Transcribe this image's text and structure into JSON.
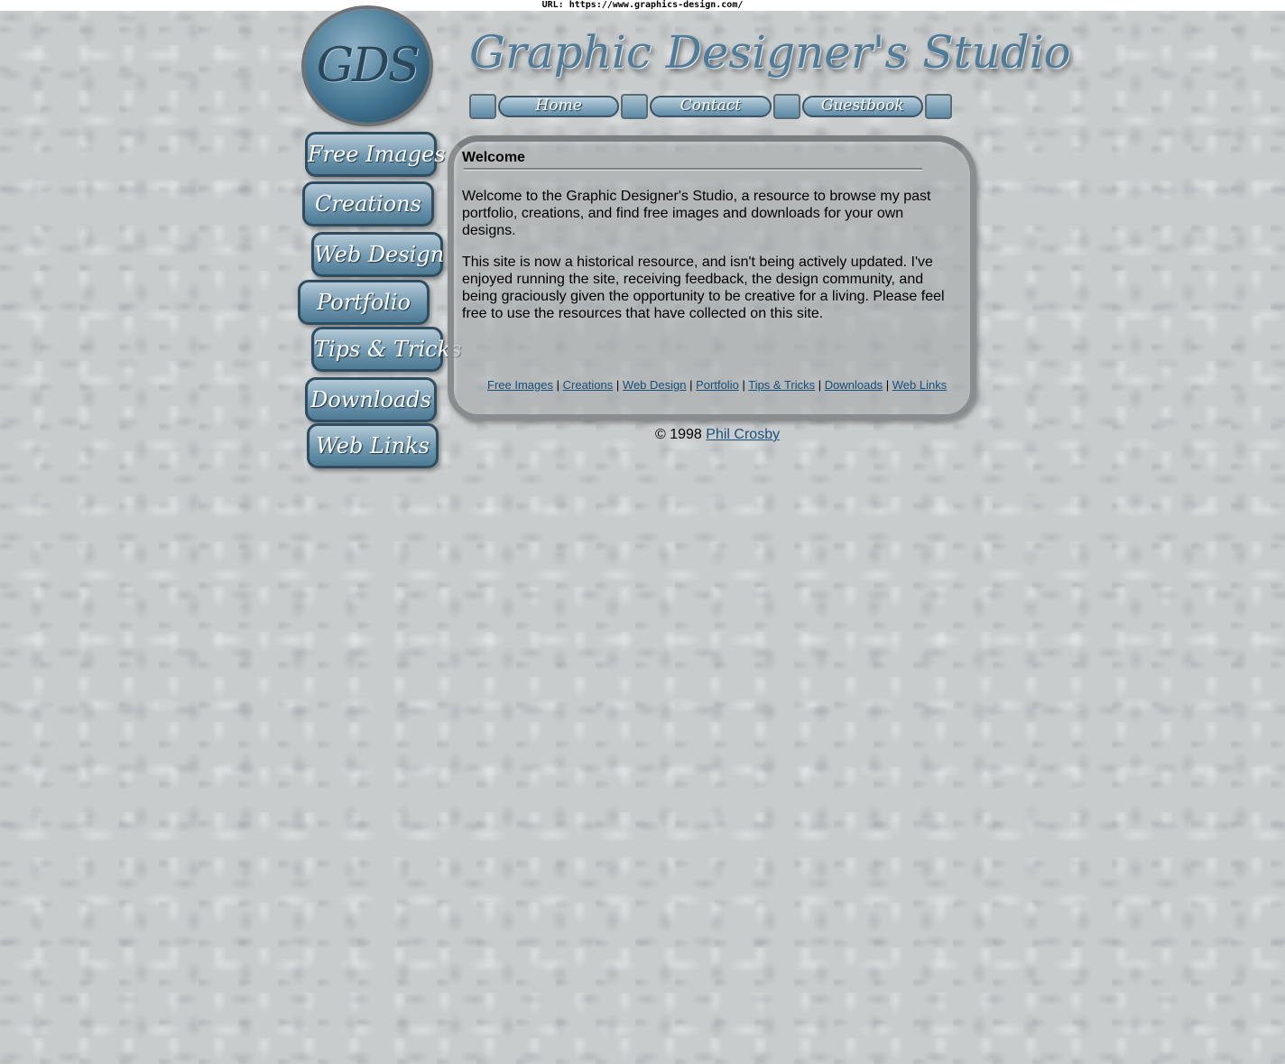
{
  "url_bar": {
    "label": "URL: https://www.graphics-design.com/"
  },
  "logo": {
    "text": "GDS"
  },
  "site_title": "Graphic Designer's Studio",
  "top_nav": {
    "items": [
      {
        "label": "Home"
      },
      {
        "label": "Contact"
      },
      {
        "label": "Guestbook"
      }
    ]
  },
  "side_nav": {
    "items": [
      {
        "label": "Free Images"
      },
      {
        "label": "Creations"
      },
      {
        "label": "Web Design"
      },
      {
        "label": "Portfolio"
      },
      {
        "label": "Tips & Tricks"
      },
      {
        "label": "Downloads"
      },
      {
        "label": "Web Links"
      }
    ]
  },
  "content": {
    "heading": "Welcome",
    "paragraphs": [
      "Welcome to the Graphic Designer's Studio, a resource to browse my past portfolio, creations, and find free images and downloads for your own designs.",
      "This site is now a historical resource, and isn't being actively updated. I've enjoyed running the site, receiving feedback, the design community, and being graciously given the opportunity to be creative for a living. Please feel free to use the resources that have collected on this site."
    ]
  },
  "footer_links": {
    "items": [
      {
        "label": "Free Images"
      },
      {
        "label": "Creations"
      },
      {
        "label": "Web Design"
      },
      {
        "label": "Portfolio"
      },
      {
        "label": "Tips & Tricks"
      },
      {
        "label": "Downloads"
      },
      {
        "label": "Web Links"
      }
    ],
    "separator": "|"
  },
  "copyright": {
    "text": "© 1998",
    "author": "Phil Crosby"
  },
  "colors": {
    "background": "#c9cccd",
    "accent": "#5e8ca8",
    "link": "#1a4f7a"
  }
}
